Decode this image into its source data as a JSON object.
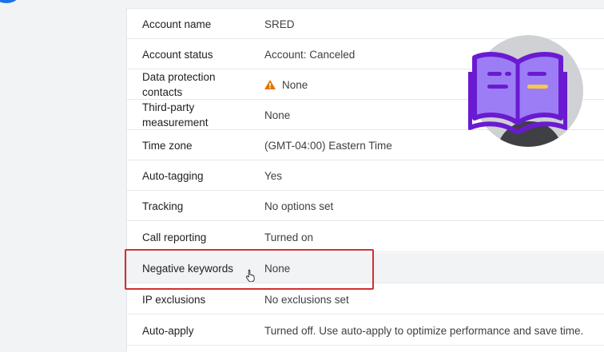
{
  "settings": {
    "rows": [
      {
        "label": "Account name",
        "value": "SRED"
      },
      {
        "label": "Account status",
        "value": "Account: Canceled"
      },
      {
        "label": "Data protection contacts",
        "value": "None",
        "warning": true
      },
      {
        "label": "Third-party measurement",
        "value": "None"
      },
      {
        "label": "Time zone",
        "value": "(GMT-04:00) Eastern Time"
      },
      {
        "label": "Auto-tagging",
        "value": "Yes"
      },
      {
        "label": "Tracking",
        "value": "No options set"
      },
      {
        "label": "Call reporting",
        "value": "Turned on"
      },
      {
        "label": "Negative keywords",
        "value": "None",
        "highlighted": true
      },
      {
        "label": "IP exclusions",
        "value": "No exclusions set"
      },
      {
        "label": "Auto-apply",
        "value": "Turned off. Use auto-apply to optimize performance and save time."
      }
    ]
  },
  "icons": {
    "warning": "warning-triangle-icon",
    "cursor": "hand-pointer-icon",
    "overlay_logo": "open-book-icon"
  },
  "colors": {
    "highlight_outline": "#d32f2f",
    "warning": "#e37400",
    "logo_fill": "#9c7df5",
    "logo_stroke": "#6a1bd1",
    "logo_accent": "#f7c948"
  }
}
